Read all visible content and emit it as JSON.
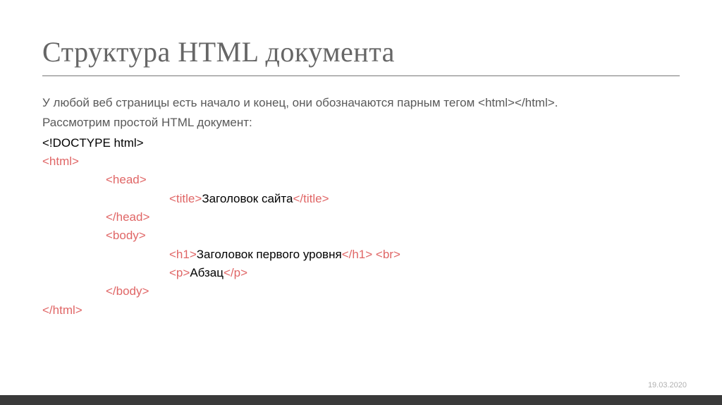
{
  "slide": {
    "title": "Структура HTML документа",
    "intro1": "У любой веб страницы есть начало и конец, они обозначаются парным тегом <html></html>.",
    "intro2": "Рассмотрим простой HTML документ:",
    "footerDate": "19.03.2020",
    "code": {
      "doctype": "<!DOCTYPE html>",
      "htmlOpen": "<html>",
      "headOpen": "<head>",
      "titleOpen": "<title>",
      "titleText": "Заголовок сайта",
      "titleClose": "</title>",
      "headClose": "</head>",
      "bodyOpen": "<body>",
      "h1Open": "<h1>",
      "h1Text": "Заголовок первого уровня",
      "h1Close": "</h1>",
      "brTag": "<br>",
      "pOpen": "<p>",
      "pText": "Абзац",
      "pClose": "</p>",
      "bodyClose": "</body>",
      "htmlClose": "</html>"
    }
  }
}
